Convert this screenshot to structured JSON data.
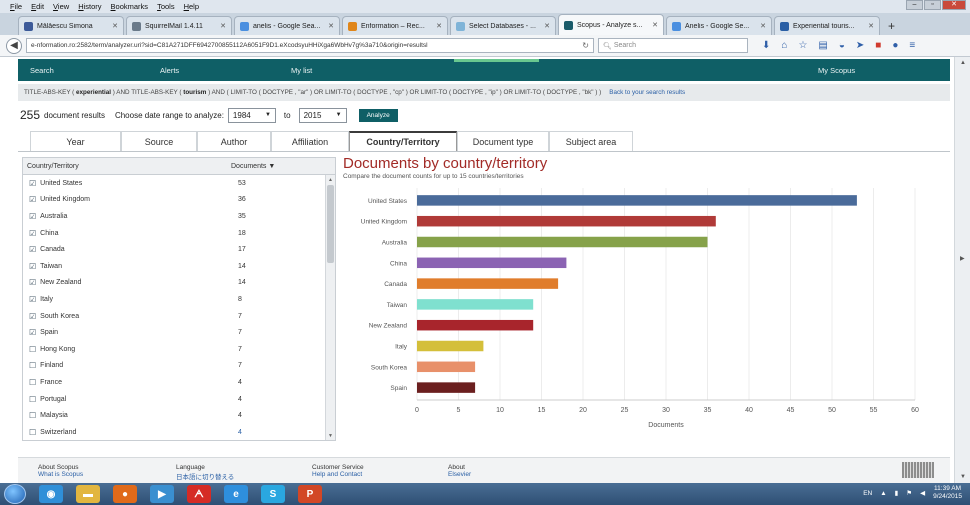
{
  "browser": {
    "menu": [
      "File",
      "Edit",
      "View",
      "History",
      "Bookmarks",
      "Tools",
      "Help"
    ],
    "tabs": [
      {
        "label": "Mălăescu Simona",
        "color": "#3b5998",
        "active": false
      },
      {
        "label": "SquirrelMail 1.4.11",
        "color": "#6a7a8a",
        "active": false
      },
      {
        "label": "anelis - Google Sea...",
        "color": "#4a8fe0",
        "active": false
      },
      {
        "label": "Enformation – Rec...",
        "color": "#e0861a",
        "active": false
      },
      {
        "label": "Select Databases - ...",
        "color": "#7fb4d8",
        "active": false
      },
      {
        "label": "Scopus - Analyze s...",
        "color": "#1a5b6a",
        "active": true
      },
      {
        "label": "Anelis - Google Se...",
        "color": "#4a8fe0",
        "active": false
      },
      {
        "label": "Experiential touris...",
        "color": "#2a5fa5",
        "active": false
      }
    ],
    "url": "e-nformation.ro:2582/term/analyzer.uri?sid=C81A271DFF6942700855112A6051F9D1.eXcodsyuHHiXga6WbHv7g%3a710&origin=resultsl",
    "search_placeholder": "Search"
  },
  "scopus": {
    "nav": {
      "search": "Search",
      "alerts": "Alerts",
      "mylist": "My list",
      "myscopus": "My Scopus"
    },
    "query_parts": [
      {
        "t": "TITLE-ABS-KEY ( ",
        "b": false
      },
      {
        "t": "experiential",
        "b": true
      },
      {
        "t": " ) AND TITLE-ABS-KEY ( ",
        "b": false
      },
      {
        "t": "tourism",
        "b": true
      },
      {
        "t": " ) AND ( LIMIT-TO ( DOCTYPE , \"ar\" ) OR LIMIT-TO ( DOCTYPE , \"cp\" ) OR LIMIT-TO ( DOCTYPE , \"ip\" ) OR LIMIT-TO ( DOCTYPE , \"bk\" ) )",
        "b": false
      }
    ],
    "back_link": "Back to your search results",
    "results_count": "255",
    "results_label": "document results",
    "date_range_label": "Choose date range to analyze:",
    "from_year": "1984",
    "to_label": "to",
    "to_year": "2015",
    "analyze_label": "Analyze",
    "tabs": [
      {
        "label": "Year",
        "active": false
      },
      {
        "label": "Source",
        "active": false
      },
      {
        "label": "Author",
        "active": false
      },
      {
        "label": "Affiliation",
        "active": false
      },
      {
        "label": "Country/Territory",
        "active": true
      },
      {
        "label": "Document type",
        "active": false
      },
      {
        "label": "Subject area",
        "active": false
      }
    ],
    "table": {
      "col_country": "Country/Territory",
      "col_docs": "Documents",
      "rows": [
        {
          "name": "United States",
          "count": "53",
          "checked": true
        },
        {
          "name": "United Kingdom",
          "count": "36",
          "checked": true
        },
        {
          "name": "Australia",
          "count": "35",
          "checked": true
        },
        {
          "name": "China",
          "count": "18",
          "checked": true
        },
        {
          "name": "Canada",
          "count": "17",
          "checked": true
        },
        {
          "name": "Taiwan",
          "count": "14",
          "checked": true
        },
        {
          "name": "New Zealand",
          "count": "14",
          "checked": true
        },
        {
          "name": "Italy",
          "count": "8",
          "checked": true
        },
        {
          "name": "South Korea",
          "count": "7",
          "checked": true
        },
        {
          "name": "Spain",
          "count": "7",
          "checked": true
        },
        {
          "name": "Hong Kong",
          "count": "7",
          "checked": false
        },
        {
          "name": "Finland",
          "count": "7",
          "checked": false
        },
        {
          "name": "France",
          "count": "4",
          "checked": false
        },
        {
          "name": "Portugal",
          "count": "4",
          "checked": false
        },
        {
          "name": "Malaysia",
          "count": "4",
          "checked": false
        },
        {
          "name": "Switzerland",
          "count": "4",
          "checked": false
        }
      ]
    },
    "chart_heading": "Documents by country/territory",
    "chart_subheading": "Compare the document counts for up to 15 countries/territories",
    "footer": [
      {
        "title": "About Scopus",
        "sub": "What is Scopus"
      },
      {
        "title": "Language",
        "sub": "日本語に切り替える"
      },
      {
        "title": "Customer Service",
        "sub": "Help and Contact"
      },
      {
        "title": "About",
        "sub": "Elsevier"
      }
    ]
  },
  "chart_data": {
    "type": "bar",
    "orientation": "horizontal",
    "categories": [
      "United States",
      "United Kingdom",
      "Australia",
      "China",
      "Canada",
      "Taiwan",
      "New Zealand",
      "Italy",
      "South Korea",
      "Spain"
    ],
    "values": [
      53,
      36,
      35,
      18,
      17,
      14,
      14,
      8,
      7,
      7
    ],
    "colors": [
      "#4a6b9a",
      "#b03a38",
      "#86a24a",
      "#8b63b3",
      "#e07d2c",
      "#7fe0cf",
      "#a8252c",
      "#d4bf3a",
      "#e8906a",
      "#6b1f1f"
    ],
    "xlabel": "Documents",
    "xticks": [
      0,
      5,
      10,
      15,
      20,
      25,
      30,
      35,
      40,
      45,
      50,
      55,
      60
    ],
    "xlim": [
      0,
      60
    ],
    "grid": true
  },
  "taskbar": {
    "icons": [
      {
        "name": "chrome-taskbar-icon",
        "color": "#2f8fd8",
        "glyph": "◉"
      },
      {
        "name": "explorer-taskbar-icon",
        "color": "#e2b640",
        "glyph": "▬"
      },
      {
        "name": "firefox-taskbar-icon",
        "color": "#e06a1a",
        "glyph": "●"
      },
      {
        "name": "media-player-taskbar-icon",
        "color": "#3a8fd0",
        "glyph": "▶"
      },
      {
        "name": "acrobat-taskbar-icon",
        "color": "#d52b25",
        "glyph": "ᗅ"
      },
      {
        "name": "ie-taskbar-icon",
        "color": "#2e8fdd",
        "glyph": "e"
      },
      {
        "name": "skype-taskbar-icon",
        "color": "#2aa7e0",
        "glyph": "S"
      },
      {
        "name": "powerpoint-taskbar-icon",
        "color": "#d24726",
        "glyph": "P"
      }
    ],
    "lang": "EN",
    "time": "11:39 AM",
    "date": "9/24/2015"
  }
}
